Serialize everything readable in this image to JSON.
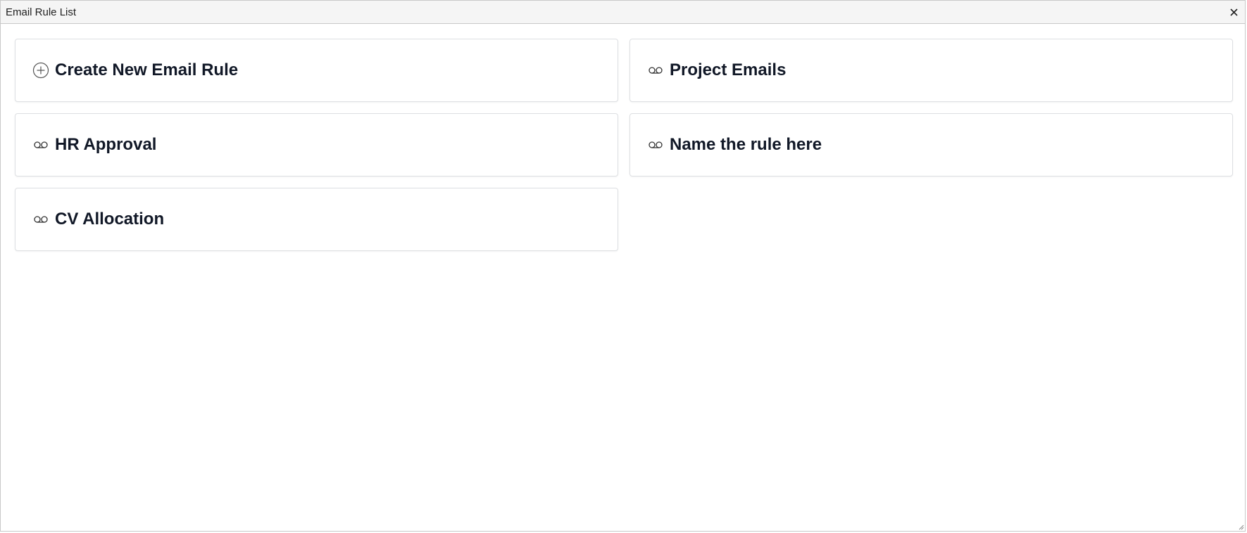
{
  "window": {
    "title": "Email Rule List",
    "close_glyph": "×"
  },
  "cards": [
    {
      "label": "Create New Email Rule",
      "icon": "plus-circle-icon"
    },
    {
      "label": "Project Emails",
      "icon": "voicemail-icon"
    },
    {
      "label": "HR Approval",
      "icon": "voicemail-icon"
    },
    {
      "label": "Name the rule here",
      "icon": "voicemail-icon"
    },
    {
      "label": "CV Allocation",
      "icon": "voicemail-icon"
    }
  ],
  "colors": {
    "titlebar_bg": "#f5f5f5",
    "card_border": "#dddfe2",
    "label_text": "#111827",
    "icon_stroke": "#555555"
  }
}
